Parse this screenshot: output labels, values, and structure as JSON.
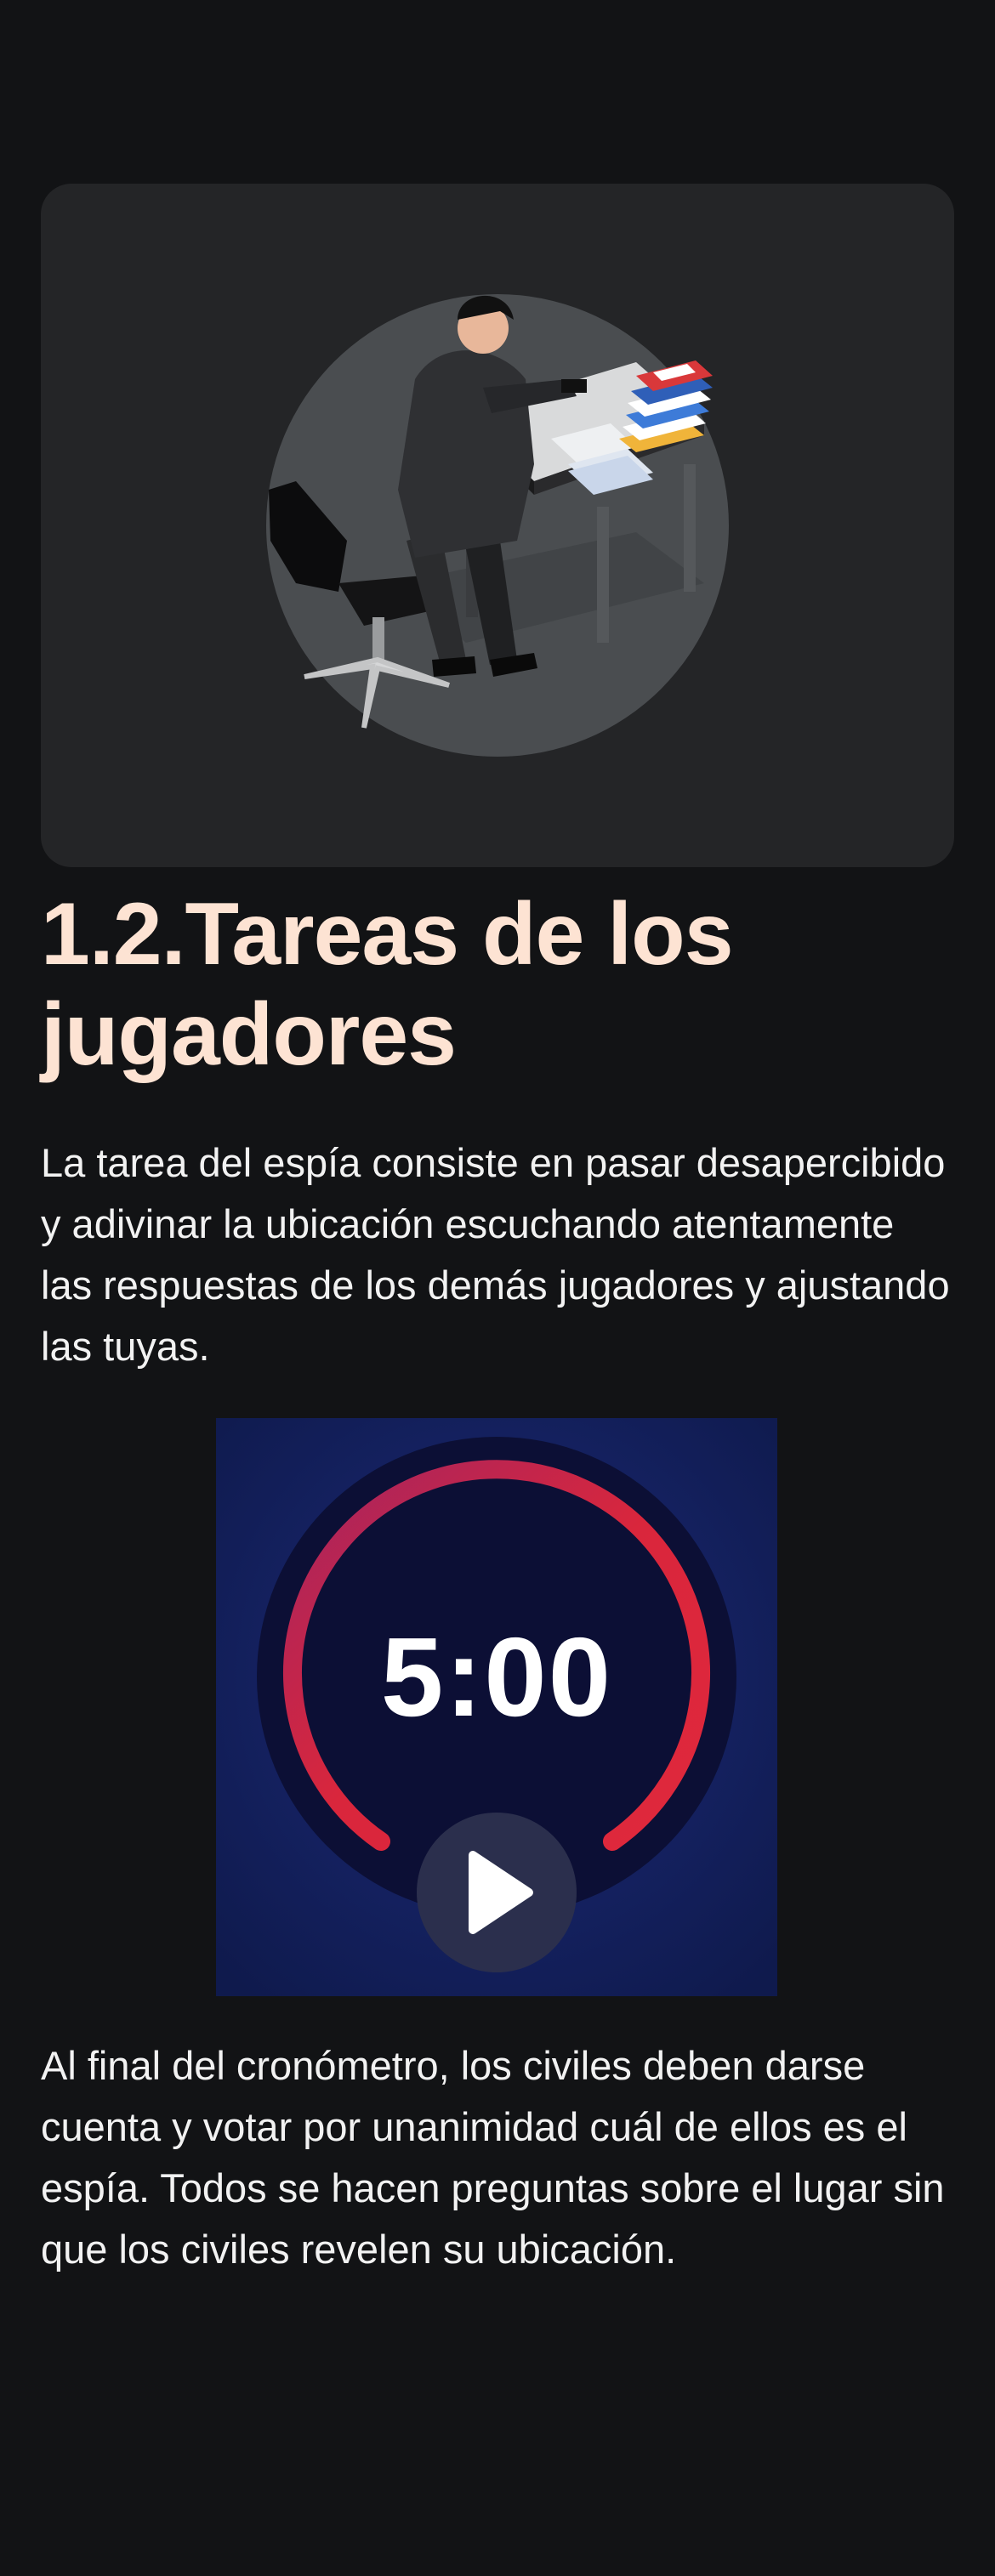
{
  "section": {
    "title": "1.2.Tareas de los jugadores",
    "paragraph_1": "La tarea del espía consiste en pasar desapercibido y adivinar la ubicación escuchando atentamente las respuestas de los demás jugadores y ajustando las tuyas.",
    "paragraph_2": "Al final del cronómetro, los civiles deben darse cuenta y votar por unanimidad cuál de ellos es el espía. Todos se hacen preguntas sobre el lugar sin que los civiles revelen su ubicación."
  },
  "timer": {
    "display": "5:00",
    "play_icon": "play-icon"
  },
  "illustration": {
    "subject": "spy-at-desk-illustration"
  },
  "colors": {
    "background": "#121315",
    "card": "#242527",
    "title": "#fde3d3",
    "timer_bg": "#101a4a",
    "timer_ring_start": "#e0283c",
    "timer_ring_end": "#a52460"
  }
}
